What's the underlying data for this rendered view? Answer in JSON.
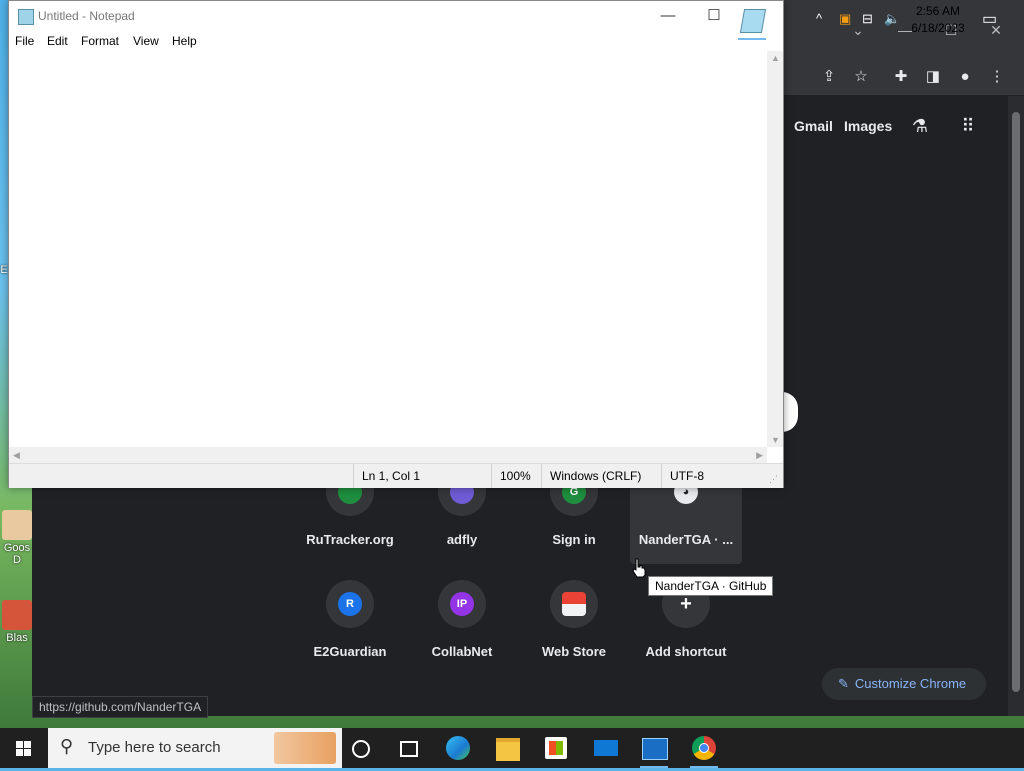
{
  "desktop": {
    "icons": [
      {
        "label": "Goos D"
      },
      {
        "label": "Blas"
      }
    ],
    "edge_text": "E"
  },
  "chrome": {
    "header_links": {
      "gmail": "Gmail",
      "images": "Images"
    },
    "shortcuts_row1": [
      {
        "label": "RuTracker.org",
        "favicon_color": "#1e8e3e",
        "favicon_text": ""
      },
      {
        "label": "adfly",
        "favicon_color": "#6f5bd4",
        "favicon_text": ""
      },
      {
        "label": "Sign in",
        "favicon_color": "#1e8e3e",
        "favicon_text": "G"
      },
      {
        "label": "NanderTGA · ...",
        "favicon_color": "#e8eaed",
        "favicon_text": ""
      }
    ],
    "shortcuts_row2": [
      {
        "label": "E2Guardian",
        "favicon_color": "#1a73e8",
        "favicon_text": "R"
      },
      {
        "label": "CollabNet",
        "favicon_color": "#9334e6",
        "favicon_text": "IP"
      },
      {
        "label": "Web Store",
        "favicon_color": "#ea4335",
        "favicon_text": ""
      },
      {
        "label": "Add shortcut",
        "favicon_color": "#35363a",
        "favicon_text": "+"
      }
    ],
    "customize_label": "Customize Chrome",
    "status_url": "https://github.com/NanderTGA",
    "tooltip": "NanderTGA · GitHub"
  },
  "notepad": {
    "title": "Untitled - Notepad",
    "menu": [
      "File",
      "Edit",
      "Format",
      "View",
      "Help"
    ],
    "content": "",
    "status": {
      "position": "Ln 1, Col 1",
      "zoom": "100%",
      "line_ending": "Windows (CRLF)",
      "encoding": "UTF-8"
    }
  },
  "taskbar": {
    "search_placeholder": "Type here to search",
    "time": "2:56 AM",
    "date": "6/18/2023"
  }
}
